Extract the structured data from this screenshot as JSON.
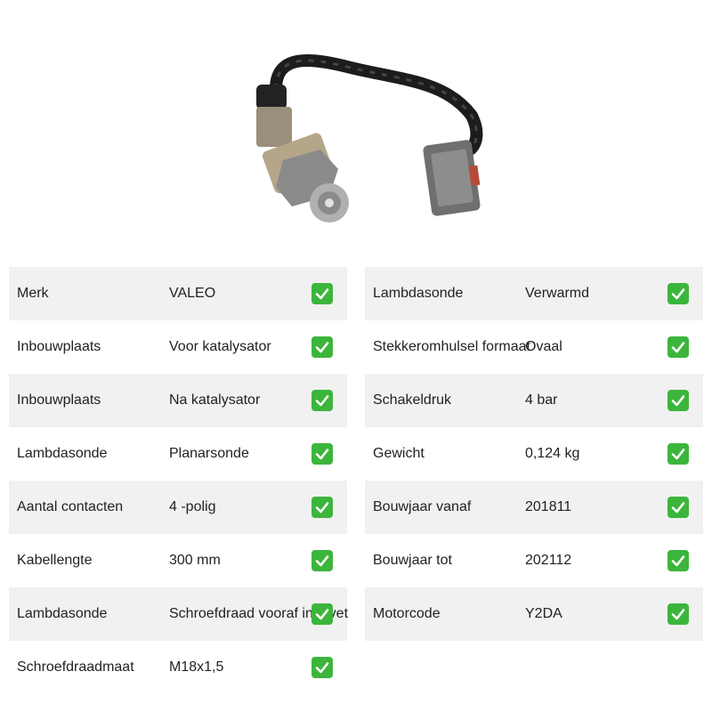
{
  "left_specs": [
    {
      "label": "Merk",
      "value": "VALEO"
    },
    {
      "label": "Inbouwplaats",
      "value": "Voor katalysator"
    },
    {
      "label": "Inbouwplaats",
      "value": "Na katalysator"
    },
    {
      "label": "Lambdasonde",
      "value": "Planarsonde"
    },
    {
      "label": "Aantal contacten",
      "value": "4 -polig"
    },
    {
      "label": "Kabellengte",
      "value": "300 mm"
    },
    {
      "label": "Lambdasonde",
      "value": "Schroefdraad vooraf ingevet"
    },
    {
      "label": "Schroefdraadmaat",
      "value": "M18x1,5"
    }
  ],
  "right_specs": [
    {
      "label": "Lambdasonde",
      "value": "Verwarmd"
    },
    {
      "label": "Stekkeromhulsel formaat",
      "value": "Ovaal"
    },
    {
      "label": "Schakeldruk",
      "value": "4 bar"
    },
    {
      "label": "Gewicht",
      "value": "0,124 kg"
    },
    {
      "label": "Bouwjaar vanaf",
      "value": "201811"
    },
    {
      "label": "Bouwjaar tot",
      "value": "202112"
    },
    {
      "label": "Motorcode",
      "value": "Y2DA"
    }
  ],
  "icons": {
    "check": "check-mark-icon",
    "check_color": "#3cb53c"
  }
}
